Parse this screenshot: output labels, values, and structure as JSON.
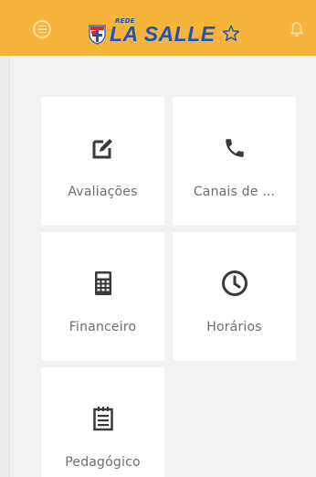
{
  "header": {
    "brand_prefix": "REDE",
    "brand_name": "LA SALLE",
    "colors": {
      "bar": "#f6b43a",
      "brand": "#1f56b3"
    }
  },
  "icons": {
    "menu": "menu-circle-icon",
    "logo": "la-salle-shield-icon",
    "star": "star-icon",
    "notifications": "bell-icon"
  },
  "tiles": [
    {
      "label": "Avaliações",
      "icon": "edit-icon"
    },
    {
      "label": "Canais de ...",
      "icon": "phone-icon"
    },
    {
      "label": "Financeiro",
      "icon": "calculator-icon"
    },
    {
      "label": "Horários",
      "icon": "clock-icon"
    },
    {
      "label": "Pedagógico",
      "icon": "notepad-icon"
    }
  ]
}
